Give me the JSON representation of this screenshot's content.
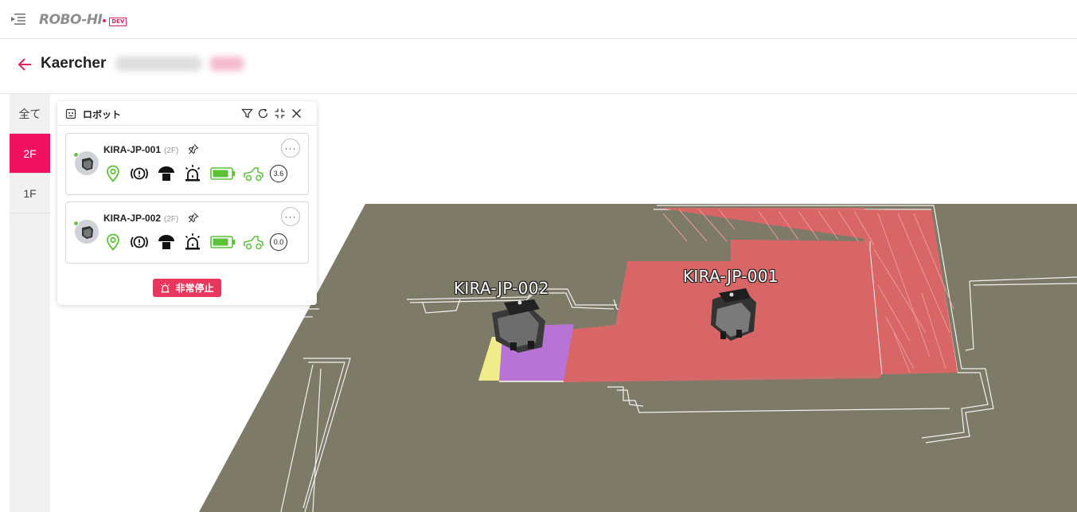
{
  "app": {
    "logo_text": "ROBO-HI",
    "env_badge": "DEV"
  },
  "header": {
    "title": "Kaercher"
  },
  "floor_tabs": [
    {
      "label": "全て",
      "active": false
    },
    {
      "label": "2F",
      "active": true
    },
    {
      "label": "1F",
      "active": false
    }
  ],
  "robot_panel": {
    "title": "ロボット",
    "robots": [
      {
        "name": "KIRA-JP-001",
        "floor": "(2F)",
        "speed": "3.6",
        "online": true
      },
      {
        "name": "KIRA-JP-002",
        "floor": "(2F)",
        "speed": "0.0",
        "online": true
      }
    ],
    "emergency_stop_label": "非常停止"
  },
  "map": {
    "labels": {
      "robot_1": "KIRA-JP-001",
      "robot_2": "KIRA-JP-002"
    }
  },
  "colors": {
    "accent": "#f0125e",
    "emergency": "#e8365d",
    "status_green": "#5bc236",
    "map_floor": "#7d7a68",
    "zone_red": "#d96a6a",
    "zone_purple": "#b873d6",
    "zone_yellow": "#f0ec8c"
  }
}
